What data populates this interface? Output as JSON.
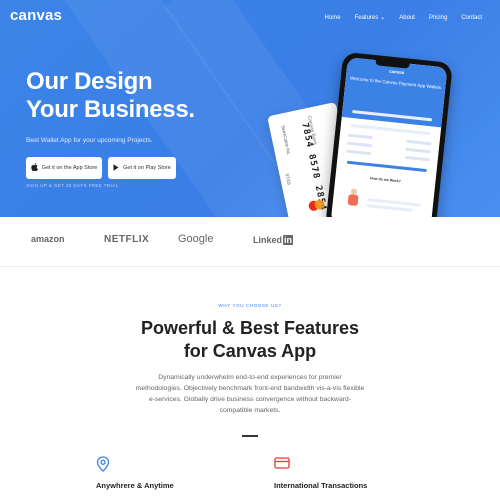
{
  "nav": {
    "logo": "canvas",
    "items": [
      {
        "label": "Home"
      },
      {
        "label": "Features"
      },
      {
        "label": "About"
      },
      {
        "label": "Pricing"
      },
      {
        "label": "Contact"
      }
    ]
  },
  "hero": {
    "title_line1": "Our Design",
    "title_line2": "Your Business.",
    "subtitle": "Best Wallet App for your upcoming Projects.",
    "app_store_label": "Get it on the App Store",
    "play_store_label": "Get it on Play Store",
    "note": "SIGN UP & GET 30 DAYS FREE TRIAL"
  },
  "card": {
    "bank": "Canvas Bank",
    "number": "7854 8578 2854 3281",
    "name": "SemiColon Inc.",
    "expiry": "07/19"
  },
  "phone": {
    "logo": "canvas",
    "title": "Welcome to the Canvas Payment App Wallets",
    "caption": "How do we Work?"
  },
  "logos": {
    "amazon": "amazon",
    "netflix": "NETFLIX",
    "google": "Google",
    "linkedin": "Linked",
    "linkedin_in": "in"
  },
  "features": {
    "eyebrow": "WHY YOU CHOOSE US?",
    "title_line1": "Powerful & Best Features",
    "title_line2": "for Canvas App",
    "description": "Dynamically underwhelm end-to-end experiences for premier methodologies. Objectively benchmark front-end bandwidth vis-a-vis flexible e-services. Globally drive business convergence without backward-compatible markets.",
    "items": [
      {
        "label": "Anywhrere & Anytime",
        "icon": "location-pin-icon"
      },
      {
        "label": "International Transactions",
        "icon": "credit-card-icon"
      }
    ]
  },
  "colors": {
    "primary": "#3c82e6",
    "feature_icon_blue": "#3c82e6",
    "feature_icon_red": "#e23c3c"
  }
}
